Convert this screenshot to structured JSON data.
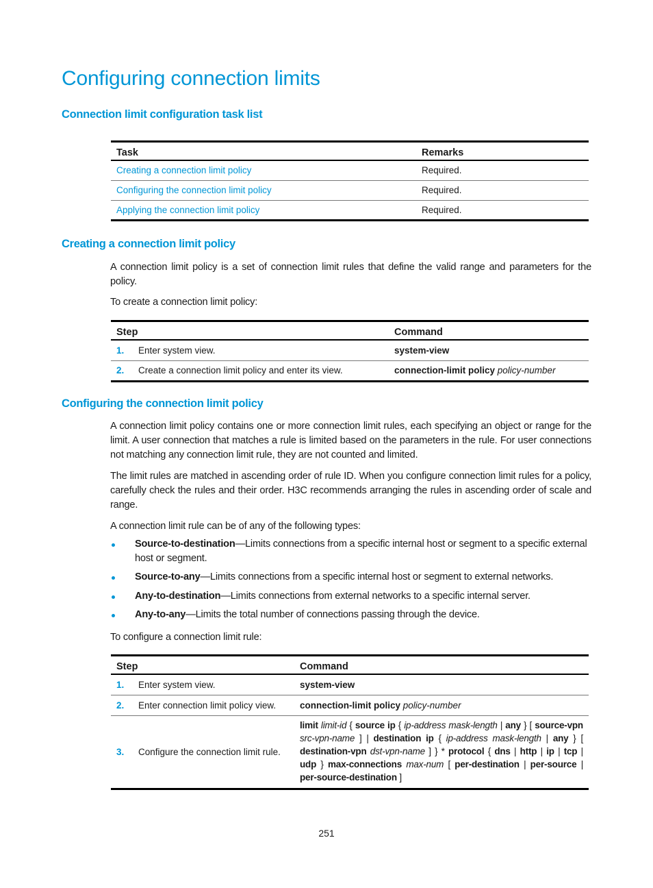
{
  "page": {
    "title": "Configuring connection limits",
    "page_number": "251"
  },
  "task_list": {
    "heading": "Connection limit configuration task list",
    "columns": [
      "Task",
      "Remarks"
    ],
    "rows": [
      {
        "task": "Creating a connection limit policy",
        "remarks": "Required."
      },
      {
        "task": "Configuring the connection limit policy",
        "remarks": "Required."
      },
      {
        "task": "Applying the connection limit policy",
        "remarks": "Required."
      }
    ]
  },
  "create_policy": {
    "heading": "Creating a connection limit policy",
    "intro": "A connection limit policy is a set of connection limit rules that define the valid range and parameters for the policy.",
    "lead": "To create a connection limit policy:",
    "columns": [
      "Step",
      "Command"
    ],
    "steps": [
      {
        "num": "1.",
        "desc": "Enter system view.",
        "cmd_bold": "system-view",
        "cmd_italic": ""
      },
      {
        "num": "2.",
        "desc": "Create a connection limit policy and enter its view.",
        "cmd_bold": "connection-limit policy",
        "cmd_italic": "policy-number"
      }
    ]
  },
  "configure_policy": {
    "heading": "Configuring the connection limit policy",
    "para1": "A connection limit policy contains one or more connection limit rules, each specifying an object or range for the limit. A user connection that matches a rule is limited based on the parameters in the rule. For user connections not matching any connection limit rule, they are not counted and limited.",
    "para2": "The limit rules are matched in ascending order of rule ID. When you configure connection limit rules for a policy, carefully check the rules and their order. H3C recommends arranging the rules in ascending order of scale and range.",
    "para3": "A connection limit rule can be of any of the following types:",
    "bullets": [
      {
        "term": "Source-to-destination",
        "text": "—Limits connections from a specific internal host or segment to a specific external host or segment."
      },
      {
        "term": "Source-to-any",
        "text": "—Limits connections from a specific internal host or segment to external networks."
      },
      {
        "term": "Any-to-destination",
        "text": "—Limits connections from external networks to a specific internal server."
      },
      {
        "term": "Any-to-any",
        "text": "—Limits the total number of connections passing through the device."
      }
    ],
    "lead": "To configure a connection limit rule:",
    "columns": [
      "Step",
      "Command"
    ],
    "steps": [
      {
        "num": "1.",
        "desc": "Enter system view.",
        "cmd_bold": "system-view",
        "cmd_italic": ""
      },
      {
        "num": "2.",
        "desc": "Enter connection limit policy view.",
        "cmd_bold": "connection-limit policy",
        "cmd_italic": "policy-number"
      },
      {
        "num": "3.",
        "desc": "Configure the connection limit rule.",
        "cmd_parts": [
          {
            "b": "limit"
          },
          {
            "t": " "
          },
          {
            "i": "limit-id"
          },
          {
            "t": " { "
          },
          {
            "b": "source ip"
          },
          {
            "t": " { "
          },
          {
            "i": "ip-address mask-length"
          },
          {
            "t": " | "
          },
          {
            "b": "any"
          },
          {
            "t": " } [ "
          },
          {
            "b": "source-vpn"
          },
          {
            "t": " "
          },
          {
            "i": "src-vpn-name"
          },
          {
            "t": " ] | "
          },
          {
            "b": "destination ip"
          },
          {
            "t": " { "
          },
          {
            "i": "ip-address mask-length"
          },
          {
            "t": " | "
          },
          {
            "b": "any"
          },
          {
            "t": " } [ "
          },
          {
            "b": "destination-vpn"
          },
          {
            "t": " "
          },
          {
            "i": "dst-vpn-name"
          },
          {
            "t": " ] } * "
          },
          {
            "b": "protocol"
          },
          {
            "t": " { "
          },
          {
            "b": "dns"
          },
          {
            "t": " | "
          },
          {
            "b": "http"
          },
          {
            "t": " | "
          },
          {
            "b": "ip"
          },
          {
            "t": " | "
          },
          {
            "b": "tcp"
          },
          {
            "t": " | "
          },
          {
            "b": "udp"
          },
          {
            "t": " } "
          },
          {
            "b": "max-connections"
          },
          {
            "t": " "
          },
          {
            "i": "max-num"
          },
          {
            "t": " [ "
          },
          {
            "b": "per-destination"
          },
          {
            "t": " | "
          },
          {
            "b": "per-source"
          },
          {
            "t": " | "
          },
          {
            "b": "per-source-destination"
          },
          {
            "t": " ]"
          }
        ]
      }
    ]
  },
  "colors": {
    "accent": "#0096d6",
    "text": "#1a1a1a"
  }
}
